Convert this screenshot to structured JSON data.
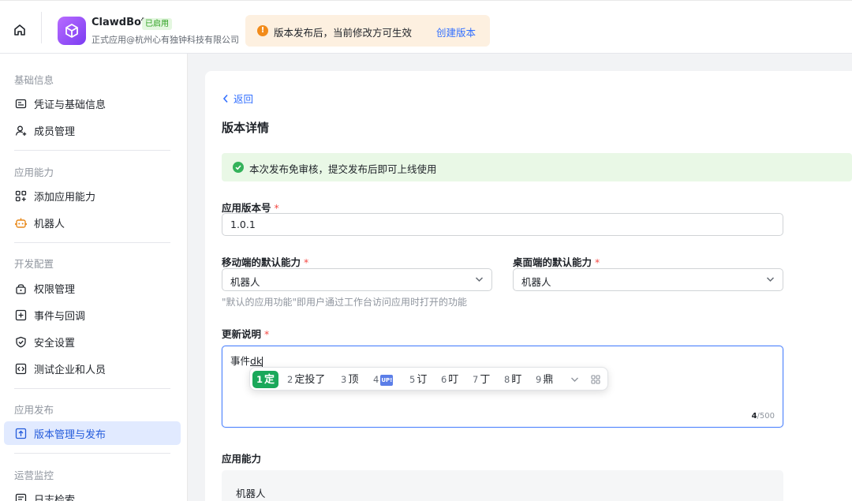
{
  "header": {
    "app_name": "ClawdBot",
    "app_status": "已启用",
    "app_subtitle": "正式应用@杭州心有独钟科技有限公司",
    "notice_text": "版本发布后，当前修改方可生效",
    "notice_link": "创建版本"
  },
  "sidebar": {
    "groups": [
      {
        "title": "基础信息",
        "items": [
          {
            "label": "凭证与基础信息",
            "icon": "id-card-icon"
          },
          {
            "label": "成员管理",
            "icon": "user-add-icon"
          }
        ]
      },
      {
        "title": "应用能力",
        "items": [
          {
            "label": "添加应用能力",
            "icon": "grid-add-icon"
          },
          {
            "label": "机器人",
            "icon": "robot-icon"
          }
        ]
      },
      {
        "title": "开发配置",
        "items": [
          {
            "label": "权限管理",
            "icon": "lock-icon"
          },
          {
            "label": "事件与回调",
            "icon": "event-icon"
          },
          {
            "label": "安全设置",
            "icon": "shield-icon"
          },
          {
            "label": "测试企业和人员",
            "icon": "code-icon"
          }
        ]
      },
      {
        "title": "应用发布",
        "items": [
          {
            "label": "版本管理与发布",
            "icon": "upload-icon",
            "active": true
          }
        ]
      },
      {
        "title": "运营监控",
        "items": [
          {
            "label": "日志检索",
            "icon": "log-icon"
          }
        ]
      }
    ]
  },
  "main": {
    "back_label": "返回",
    "title": "版本详情",
    "success_banner": "本次发布免审核，提交发布后即可上线使用",
    "version_label": "应用版本号",
    "version_value": "1.0.1",
    "mobile_label": "移动端的默认能力",
    "mobile_value": "机器人",
    "desktop_label": "桌面端的默认能力",
    "desktop_value": "机器人",
    "default_hint": "\"默认的应用功能\"即用户通过工作台访问应用时打开的功能",
    "notes_label": "更新说明",
    "notes_text": "事件",
    "notes_composing": "dk",
    "notes_count": "4",
    "notes_max": "/500",
    "capability_label": "应用能力",
    "capability_item": "机器人"
  },
  "ime": {
    "candidates": [
      {
        "num": "1",
        "text": "定"
      },
      {
        "num": "2",
        "text": "定投了"
      },
      {
        "num": "3",
        "text": "顶"
      },
      {
        "num": "4",
        "text": "UP!"
      },
      {
        "num": "5",
        "text": "订"
      },
      {
        "num": "6",
        "text": "叮"
      },
      {
        "num": "7",
        "text": "丁"
      },
      {
        "num": "8",
        "text": "盯"
      },
      {
        "num": "9",
        "text": "鼎"
      }
    ]
  },
  "colors": {
    "accent": "#3370ff",
    "active_bg": "#e1eaff",
    "success_bg": "#e9f8e6",
    "success": "#34b25a",
    "warning_bg": "#fdf0e0",
    "warning": "#f28b1a",
    "required": "#f54a45",
    "ime_selected": "#1aa85a"
  }
}
